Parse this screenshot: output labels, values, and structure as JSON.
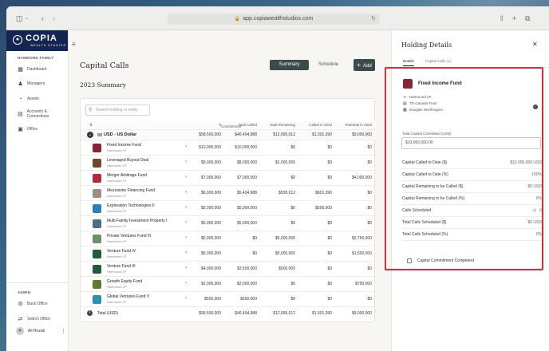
{
  "browser": {
    "url": "app.copiawealthstudios.com"
  },
  "brand": {
    "name": "COPIA",
    "subtitle": "WEALTH STUDIOS",
    "color": "#132550"
  },
  "sidebar": {
    "section": "HAMMOND FAMILY",
    "items": [
      {
        "label": "Dashboard",
        "icon": "grid-icon"
      },
      {
        "label": "Managers",
        "icon": "people-icon"
      },
      {
        "label": "Assets",
        "icon": "pie-icon"
      },
      {
        "label": "Accounts & Connections",
        "icon": "bank-icon"
      },
      {
        "label": "Office",
        "icon": "folder-icon"
      }
    ],
    "admin_label": "ADMIN",
    "admin_items": [
      {
        "label": "Back Office",
        "icon": "gear-icon"
      },
      {
        "label": "Switch Office",
        "icon": "swap-icon"
      }
    ],
    "user": "Ali Rozak"
  },
  "main": {
    "title": "Capital Calls",
    "segments": [
      "Summary",
      "Schedule"
    ],
    "add_label": "Add",
    "summary_title": "2023 Summary",
    "search_placeholder": "Search holding or entity",
    "columns": [
      "Commitment",
      "Total Called",
      "Total Remaining",
      "Called in 2023",
      "Potential in 2023"
    ],
    "group": {
      "label": "USD - US Dollar",
      "values": [
        "$58,500,000",
        "$46,404,988",
        "$12,095,012",
        "$1,301,390",
        "$9,000,000"
      ]
    },
    "holdings": [
      {
        "name": "Fixed Income Fund",
        "sub": "Hammond LP",
        "color": "#8c2233",
        "values": [
          "$10,000,000",
          "$10,000,000",
          "$0",
          "$0",
          "$0"
        ]
      },
      {
        "name": "Leveraged Buyout Deal",
        "sub": "Hammond LP",
        "color": "#6b4a2a",
        "values": [
          "$9,000,000",
          "$8,000,000",
          "$1,000,000",
          "$0",
          "$0"
        ]
      },
      {
        "name": "Merger Arbitrage Fund",
        "sub": "Hammond LP",
        "color": "#b3283a",
        "values": [
          "$7,000,000",
          "$7,000,000",
          "$0",
          "$0",
          "$4,000,000"
        ]
      },
      {
        "name": "Mezzanine Financing Fund",
        "sub": "Hammond LP",
        "color": "#9a8f80",
        "values": [
          "$6,000,000",
          "$5,404,988",
          "$595,012",
          "$801,390",
          "$0"
        ]
      },
      {
        "name": "Exploration Technologies II",
        "sub": "Hammond LP",
        "color": "#2d7fb6",
        "values": [
          "$5,000,000",
          "$5,000,000",
          "$0",
          "$500,000",
          "$0"
        ]
      },
      {
        "name": "Multi Family Investment Property I",
        "sub": "Hammond LP",
        "color": "#4a6f8c",
        "values": [
          "$5,000,000",
          "$5,000,000",
          "$0",
          "$0",
          "$0"
        ]
      },
      {
        "name": "Private Ventures Fund III",
        "sub": "Hammond LP",
        "color": "#6f8f6a",
        "values": [
          "$5,000,000",
          "$0",
          "$5,000,000",
          "$0",
          "$2,750,000"
        ]
      },
      {
        "name": "Venture Fund IV",
        "sub": "Hammond LP",
        "color": "#1f5e3a",
        "values": [
          "$5,000,000",
          "$0",
          "$5,000,000",
          "$0",
          "$1,500,000"
        ]
      },
      {
        "name": "Venture Fund III",
        "sub": "Hammond LP",
        "color": "#1f5e3a",
        "values": [
          "$4,000,000",
          "$3,500,000",
          "$500,000",
          "$0",
          "$0"
        ]
      },
      {
        "name": "Growth Equity Fund",
        "sub": "Hammond LP",
        "color": "#5f7a2c",
        "values": [
          "$2,000,000",
          "$2,000,000",
          "$0",
          "$0",
          "$750,000"
        ]
      },
      {
        "name": "Global Ventures Fund V",
        "sub": "Hammond LP",
        "color": "#2f8fb0",
        "values": [
          "$500,000",
          "$500,000",
          "$0",
          "$0",
          "$0"
        ]
      }
    ],
    "total": {
      "label": "Total (USD)",
      "values": [
        "$58,500,000",
        "$46,404,988",
        "$12,095,012",
        "$1,301,390",
        "$9,000,000"
      ]
    }
  },
  "panel": {
    "title": "Holding Details",
    "tabs": [
      "Details",
      "Capital Calls (1)"
    ],
    "fund_name": "Fixed Income Fund",
    "meta": [
      {
        "icon": "entity-icon",
        "text": "Hammond LP"
      },
      {
        "icon": "bank-icon",
        "text": "TD Canada Trust"
      },
      {
        "icon": "person-card-icon",
        "text": "Douglas Worthington"
      }
    ],
    "commit_label": "Total Capital Committed (USD)",
    "commit_value": "$10,000,000.00",
    "rows": [
      {
        "label": "Capital Called to Date ($)",
        "value": "$10,000,000 USD"
      },
      {
        "label": "Capital Called to Date (%)",
        "value": "100%"
      },
      {
        "label": "Capital Remaining to be Called ($)",
        "value": "$0 USD"
      },
      {
        "label": "Capital Remaining to be Called (%)",
        "value": "0%"
      },
      {
        "label": "Calls Scheduled",
        "value": "0"
      },
      {
        "label": "Total Calls Scheduled ($)",
        "value": "$0 USD"
      },
      {
        "label": "Total Calls Scheduled (%)",
        "value": "0%"
      }
    ],
    "checkbox_label": "Capital Commitment Completed",
    "highlight_color": "#e2283a"
  }
}
